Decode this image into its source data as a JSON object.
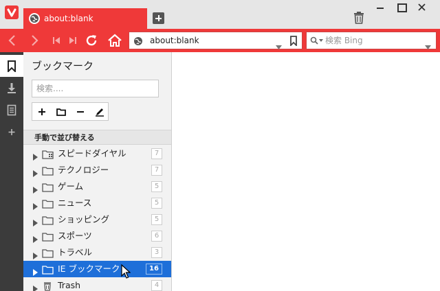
{
  "window": {
    "tab_title": "about:blank",
    "accent_color": "#ef3939"
  },
  "address_bar": {
    "url": "about:blank",
    "search_placeholder": "検索 Bing"
  },
  "icons": {
    "logo": "vivaldi-logo-icon",
    "globe": "globe-icon",
    "new_tab": "plus-icon",
    "trash": "trash-icon",
    "back": "back-arrow-icon",
    "forward": "forward-arrow-icon",
    "rewind": "rewind-icon",
    "fast_forward": "fast-forward-icon",
    "reload": "reload-icon",
    "home": "home-icon"
  },
  "bookmark_panel": {
    "title": "ブックマーク",
    "search_placeholder": "検索....",
    "sort_label": "手動で並び替える",
    "selected_color": "#1e6fd9",
    "items": [
      {
        "label": "スピードダイヤル",
        "count": "7"
      },
      {
        "label": "テクノロジー",
        "count": "7"
      },
      {
        "label": "ゲーム",
        "count": "5"
      },
      {
        "label": "ニュース",
        "count": "5"
      },
      {
        "label": "ショッピング",
        "count": "5"
      },
      {
        "label": "スポーツ",
        "count": "6"
      },
      {
        "label": "トラベル",
        "count": "3"
      },
      {
        "label": "IE ブックマーク",
        "count": "16",
        "selected": true
      },
      {
        "label": "Trash",
        "count": "4"
      }
    ]
  }
}
